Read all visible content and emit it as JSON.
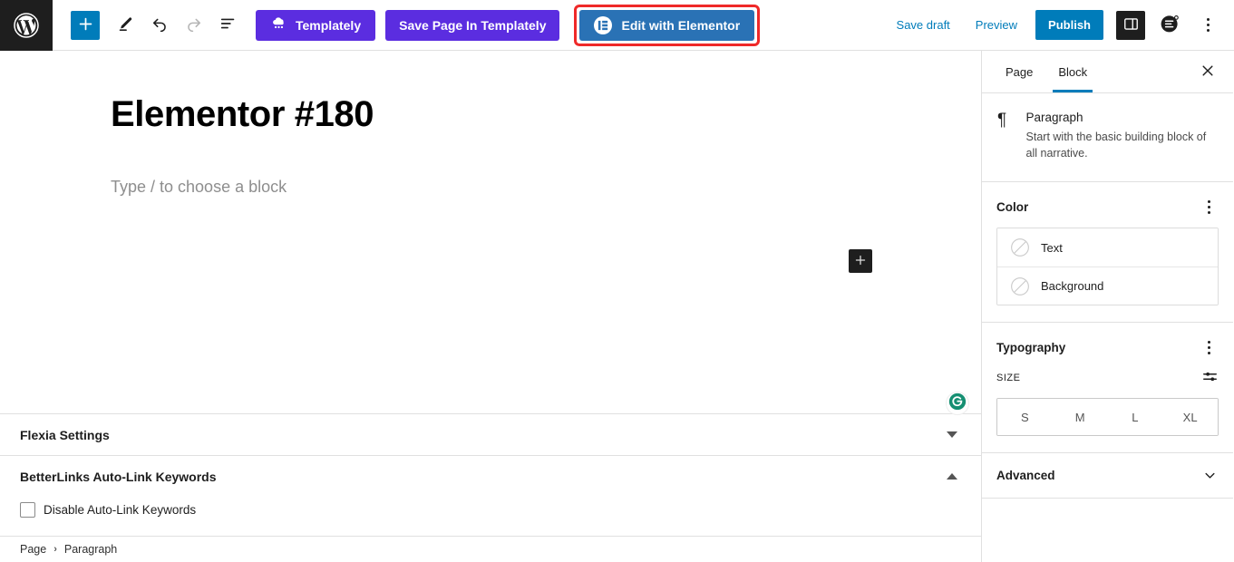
{
  "toolbar": {
    "wp_logo_icon": "wordpress-logo-icon",
    "add_block_label": "+",
    "add_block_icon": "plus-icon",
    "edit_tool_icon": "pencil-icon",
    "undo_icon": "undo-arrow-icon",
    "redo_icon": "redo-arrow-icon",
    "list_view_icon": "list-view-icon",
    "templately_label": "Templately",
    "templately_icon": "templately-cloud-icon",
    "save_page_templately_label": "Save Page In Templately",
    "edit_elementor_label": "Edit with Elementor",
    "elementor_icon": "elementor-e-icon",
    "save_draft_label": "Save draft",
    "preview_label": "Preview",
    "publish_label": "Publish",
    "settings_panel_icon": "sidebar-panel-icon",
    "plugin_icon": "jetpack-circle-icon",
    "more_options_icon": "kebab-menu-icon",
    "highlight_color": "#ef2929",
    "accent_blue": "#007cba",
    "elementor_blue": "#2a72b5",
    "templately_purple": "#5b2de0"
  },
  "editor": {
    "post_title": "Elementor #180",
    "paragraph_placeholder": "Type / to choose a block",
    "inline_add_icon": "plus-icon",
    "inline_add_label": "+",
    "teal_badge_icon": "teal-circle-icon",
    "teal_badge_color": "#168f72"
  },
  "metaboxes": [
    {
      "title": "Flexia Settings",
      "toggle_icon": "triangle-down-icon",
      "expanded": false
    },
    {
      "title": "BetterLinks Auto-Link Keywords",
      "toggle_icon": "triangle-up-icon",
      "expanded": true,
      "checkbox_label": "Disable Auto-Link Keywords",
      "checkbox_checked": false
    }
  ],
  "breadcrumb": {
    "items": [
      "Page",
      "Paragraph"
    ],
    "separator": "›"
  },
  "sidebar": {
    "tabs": [
      {
        "label": "Page",
        "active": false
      },
      {
        "label": "Block",
        "active": true
      }
    ],
    "close_icon": "close-x-icon",
    "block_card": {
      "icon": "paragraph-pilcrow-icon",
      "icon_glyph": "¶",
      "name": "Paragraph",
      "description": "Start with the basic building block of all narrative."
    },
    "color_section": {
      "title": "Color",
      "options_icon": "kebab-menu-icon",
      "rows": [
        {
          "label": "Text",
          "swatch_icon": "empty-swatch-icon",
          "value": ""
        },
        {
          "label": "Background",
          "swatch_icon": "empty-swatch-icon",
          "value": ""
        }
      ]
    },
    "typography_section": {
      "title": "Typography",
      "options_icon": "kebab-menu-icon",
      "size_label": "SIZE",
      "size_advanced_icon": "sliders-icon",
      "size_options": [
        "S",
        "M",
        "L",
        "XL"
      ],
      "selected_size": ""
    },
    "advanced_section": {
      "title": "Advanced",
      "chevron_icon": "chevron-down-icon",
      "expanded": false
    }
  }
}
